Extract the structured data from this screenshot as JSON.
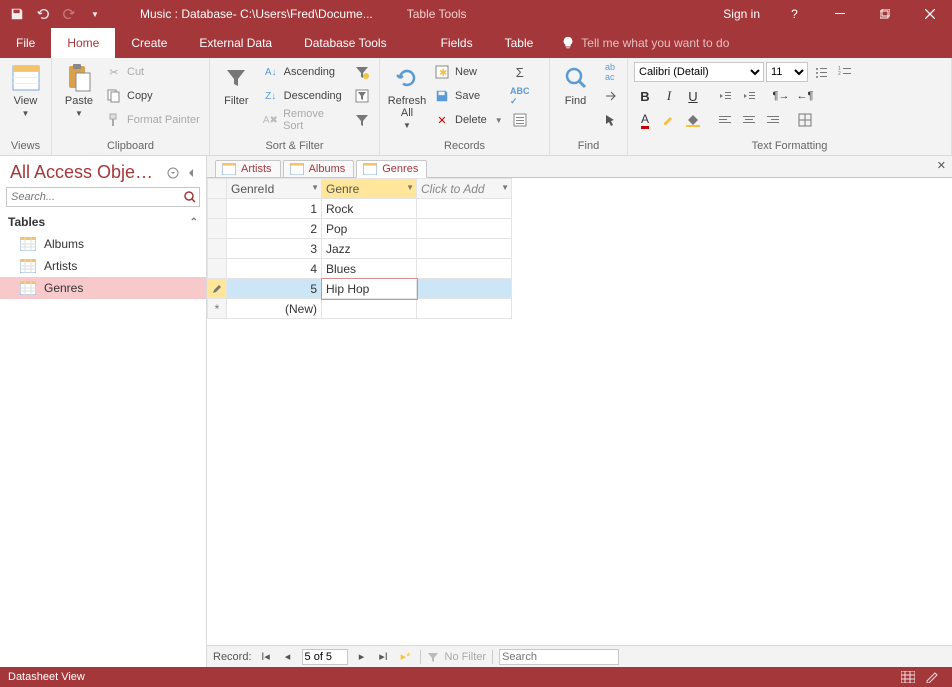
{
  "titlebar": {
    "title": "Music : Database- C:\\Users\\Fred\\Docume...",
    "context_title": "Table Tools",
    "signin": "Sign in"
  },
  "tabs": {
    "file": "File",
    "home": "Home",
    "create": "Create",
    "external": "External Data",
    "dbtools": "Database Tools",
    "fields": "Fields",
    "table": "Table",
    "tellme": "Tell me what you want to do"
  },
  "ribbon": {
    "views": {
      "view": "View",
      "group": "Views"
    },
    "clipboard": {
      "paste": "Paste",
      "cut": "Cut",
      "copy": "Copy",
      "painter": "Format Painter",
      "group": "Clipboard"
    },
    "sortfilter": {
      "filter": "Filter",
      "asc": "Ascending",
      "desc": "Descending",
      "remove": "Remove Sort",
      "group": "Sort & Filter"
    },
    "records": {
      "refresh": "Refresh All",
      "new": "New",
      "save": "Save",
      "delete": "Delete",
      "group": "Records"
    },
    "find": {
      "find": "Find",
      "group": "Find"
    },
    "text": {
      "font": "Calibri (Detail)",
      "size": "11",
      "group": "Text Formatting"
    }
  },
  "nav": {
    "title": "All Access Obje…",
    "search_ph": "Search...",
    "group": "Tables",
    "items": [
      "Albums",
      "Artists",
      "Genres"
    ]
  },
  "doctabs": [
    "Artists",
    "Albums",
    "Genres"
  ],
  "sheet": {
    "cols": {
      "id": "GenreId",
      "genre": "Genre",
      "add": "Click to Add"
    },
    "rows": [
      {
        "id": "1",
        "genre": "Rock"
      },
      {
        "id": "2",
        "genre": "Pop"
      },
      {
        "id": "3",
        "genre": "Jazz"
      },
      {
        "id": "4",
        "genre": "Blues"
      },
      {
        "id": "5",
        "genre": "Hip Hop"
      }
    ],
    "newrow": "(New)"
  },
  "recordnav": {
    "label": "Record:",
    "pos": "5 of 5",
    "nofilter": "No Filter",
    "search_ph": "Search"
  },
  "status": {
    "view": "Datasheet View"
  }
}
